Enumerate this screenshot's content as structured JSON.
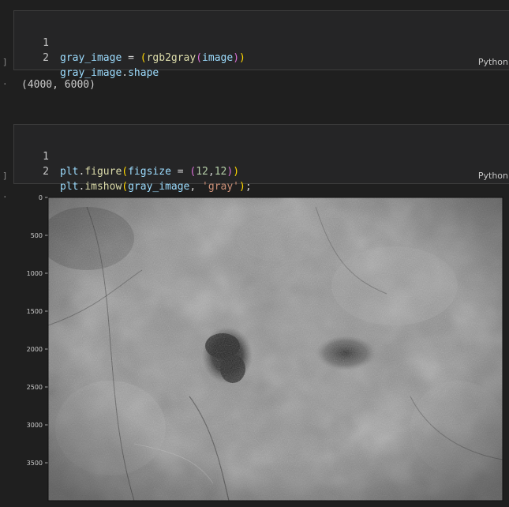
{
  "cell1": {
    "line_numbers": [
      "1",
      "2"
    ],
    "line1": {
      "var": "gray_image",
      "eq": " = ",
      "open_outer": "(",
      "fn": "rgb2gray",
      "open_inner": "(",
      "arg": "image",
      "close_inner": ")",
      "close_outer": ")"
    },
    "line2": {
      "var": "gray_image",
      "dot": ".",
      "attr": "shape"
    },
    "language": "Python"
  },
  "output1": "(4000, 6000)",
  "cell2": {
    "line_numbers": [
      "1",
      "2"
    ],
    "line1": {
      "obj": "plt",
      "dot": ".",
      "fn": "figure",
      "open": "(",
      "kw": "figsize",
      "eq": " = ",
      "open_inner": "(",
      "n1": "12",
      "comma": ",",
      "n2": "12",
      "close_inner": ")",
      "close": ")"
    },
    "line2": {
      "obj": "plt",
      "dot": ".",
      "fn": "imshow",
      "open": "(",
      "arg": "gray_image",
      "comma": ", ",
      "str": "'gray'",
      "close": ")",
      "semi": ";"
    },
    "language": "Python"
  },
  "gutter_marks": [
    "]",
    "·",
    "]",
    "·"
  ],
  "figure": {
    "y_ticks": [
      "0",
      "500",
      "1000",
      "1500",
      "2000",
      "2500",
      "3000",
      "3500"
    ],
    "y_tick_values": [
      0,
      500,
      1000,
      1500,
      2000,
      2500,
      3000,
      3500
    ],
    "y_range": [
      0,
      4000
    ],
    "image_description_colormap": "gray"
  }
}
